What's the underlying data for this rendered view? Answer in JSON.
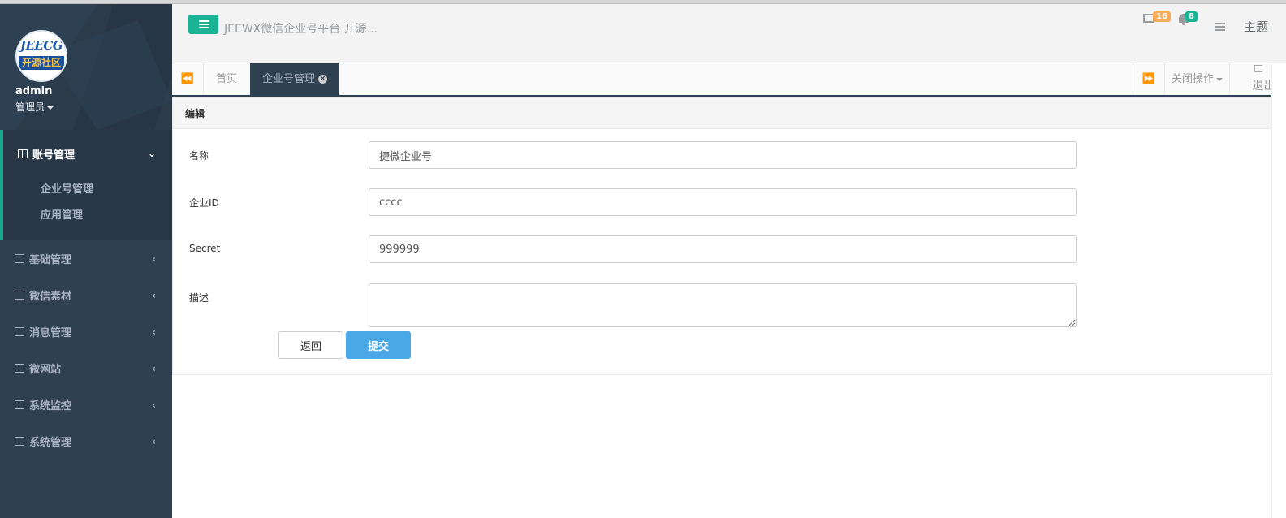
{
  "logo": {
    "top_text": "JEECG",
    "bottom_text": "开源社区"
  },
  "profile": {
    "name": "admin",
    "role": "管理员"
  },
  "sidebar": {
    "groups": [
      {
        "label": "账号管理",
        "arrow": "⌄",
        "sub": [
          "企业号管理",
          "应用管理"
        ]
      },
      {
        "label": "基础管理",
        "arrow": "‹"
      },
      {
        "label": "微信素材",
        "arrow": "‹"
      },
      {
        "label": "消息管理",
        "arrow": "‹"
      },
      {
        "label": "微网站",
        "arrow": "‹"
      },
      {
        "label": "系统监控",
        "arrow": "‹"
      },
      {
        "label": "系统管理",
        "arrow": "‹"
      }
    ]
  },
  "header": {
    "title": "JEEWX微信企业号平台 开源...",
    "mail_count": "16",
    "alert_count": "8",
    "theme_label": "主题",
    "colors": {
      "mail_badge": "#f8ac59",
      "alert_badge": "#1ab394",
      "primary": "#1ab394"
    }
  },
  "tabs": {
    "items": [
      "首页",
      "企业号管理"
    ],
    "close_ops": "关闭操作",
    "logout": "退出"
  },
  "form": {
    "panel_title": "编辑",
    "fields": [
      {
        "label": "名称",
        "value": "捷微企业号"
      },
      {
        "label": "企业ID",
        "value": "cccc"
      },
      {
        "label": "Secret",
        "value": "999999"
      },
      {
        "label": "描述",
        "value": ""
      }
    ],
    "back_label": "返回",
    "submit_label": "提交"
  }
}
